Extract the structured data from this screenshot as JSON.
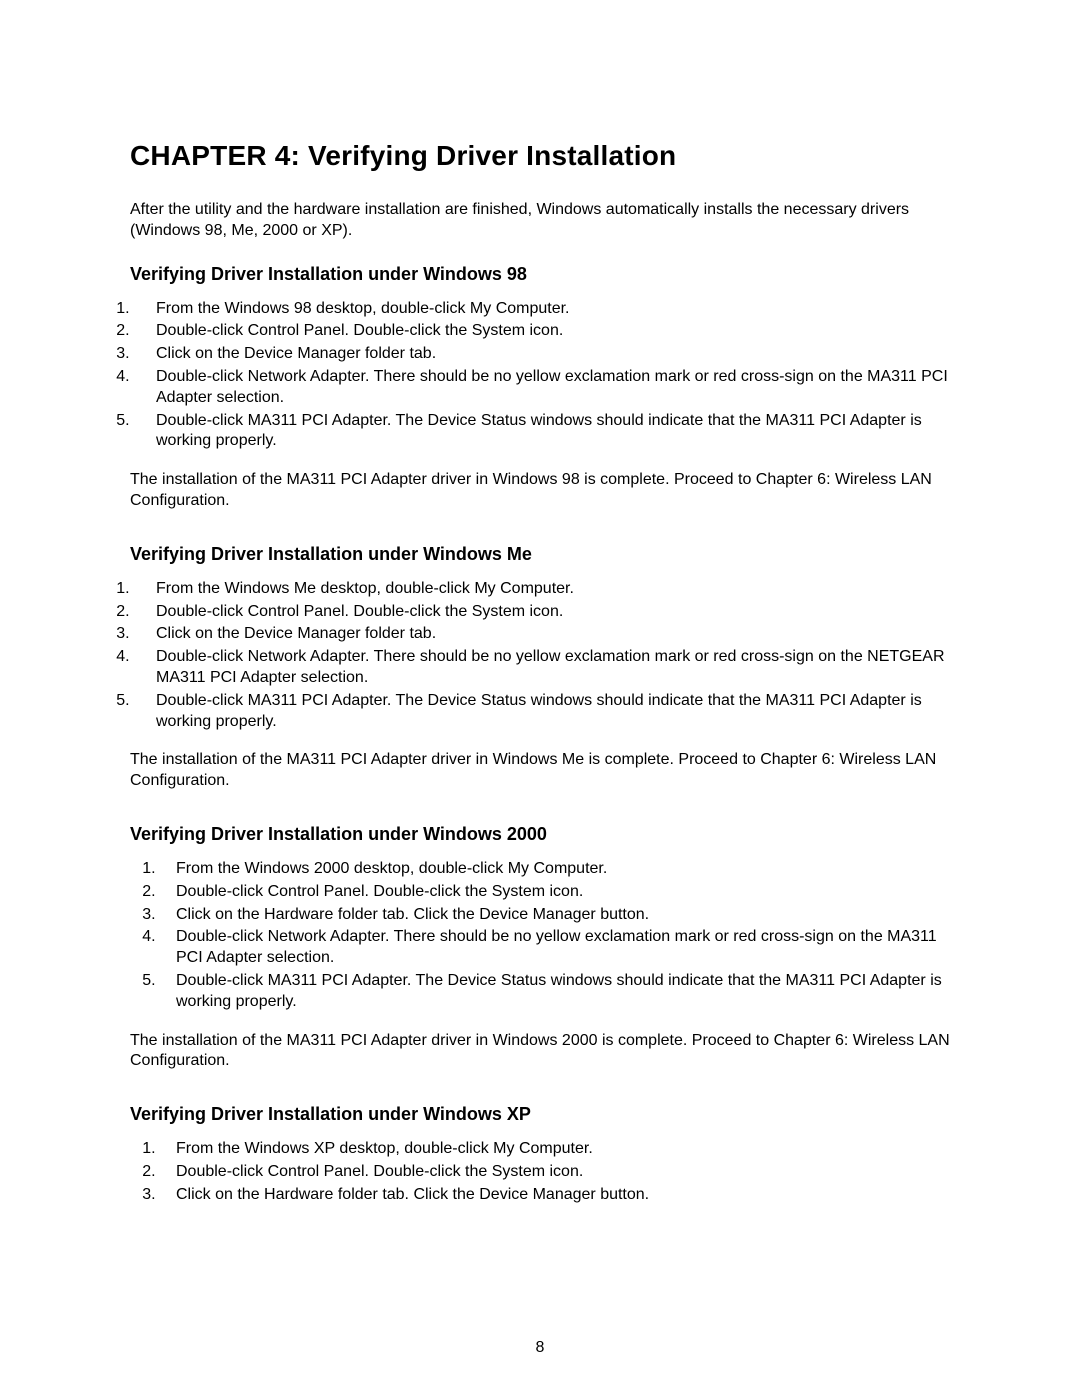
{
  "chapter": {
    "prefix": "CHAPTER 4:",
    "title": "Verifying Driver Installation"
  },
  "intro": "After the utility and the hardware installation are finished, Windows automatically installs the necessary drivers (Windows 98, Me, 2000 or XP).",
  "sections": [
    {
      "heading": "Verifying Driver Installation under Windows 98",
      "list_style": "wide",
      "steps": [
        "From the Windows 98 desktop, double-click My Computer.",
        "Double-click Control Panel. Double-click the System icon.",
        "Click on the Device Manager folder tab.",
        "Double-click Network Adapter. There should be no yellow exclamation mark or red cross-sign on the MA311 PCI Adapter selection.",
        "Double-click MA311 PCI Adapter. The Device Status windows should indicate that the MA311 PCI Adapter is working properly."
      ],
      "after": "The installation of the MA311 PCI Adapter driver in Windows 98 is complete. Proceed to Chapter 6: Wireless LAN Configuration."
    },
    {
      "heading": "Verifying Driver Installation under Windows Me",
      "list_style": "wide",
      "steps": [
        "From the Windows Me desktop, double-click My Computer.",
        "Double-click Control Panel. Double-click the System icon.",
        "Click on the Device Manager folder tab.",
        "Double-click Network Adapter. There should be no yellow exclamation mark or red cross-sign on the NETGEAR MA311 PCI Adapter selection.",
        "Double-click MA311 PCI Adapter. The Device Status windows should indicate that the MA311 PCI Adapter is working properly."
      ],
      "after": "The installation of the MA311 PCI Adapter driver in Windows Me is complete. Proceed to Chapter 6: Wireless LAN Configuration."
    },
    {
      "heading": "Verifying Driver Installation under Windows 2000",
      "list_style": "indent",
      "steps": [
        "From the Windows 2000 desktop, double-click My Computer.",
        "Double-click Control Panel. Double-click the System icon.",
        "Click on the Hardware folder tab. Click the Device Manager button.",
        "Double-click Network Adapter. There should be no yellow exclamation mark or red cross-sign on the MA311 PCI Adapter selection.",
        "Double-click MA311 PCI Adapter. The Device Status windows should indicate that the MA311 PCI Adapter is working properly."
      ],
      "after": "The installation of the MA311 PCI Adapter driver in Windows 2000 is complete. Proceed to Chapter 6: Wireless LAN Configuration."
    },
    {
      "heading": "Verifying Driver Installation under Windows XP",
      "list_style": "indent",
      "steps": [
        "From the Windows XP desktop, double-click My Computer.",
        "Double-click Control Panel. Double-click the System icon.",
        "Click on the Hardware folder tab. Click the Device Manager button."
      ],
      "after": ""
    }
  ],
  "page_number": "8"
}
